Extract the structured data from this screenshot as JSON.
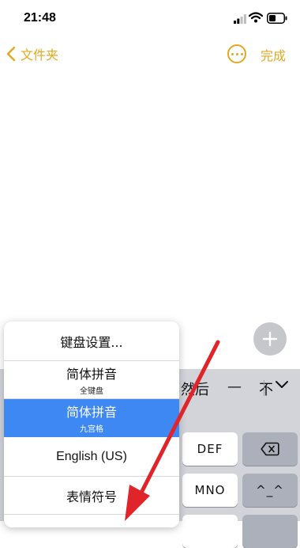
{
  "status_bar": {
    "time": "21:48",
    "icons": [
      "signal-icon",
      "wifi-icon",
      "battery-icon"
    ]
  },
  "nav": {
    "back_label": "文件夹",
    "more_icon": "ellipsis-circle-icon",
    "done_label": "完成",
    "accent_color": "#e2a81f"
  },
  "keyboard": {
    "candidates": [
      "然后",
      "—",
      "不"
    ],
    "keys": {
      "def": "DEF",
      "mno": "MNO",
      "emoticon": "^_^",
      "delete_icon": "delete-backspace-icon"
    }
  },
  "language_menu": {
    "items": [
      {
        "label": "键盘设置...",
        "sub": ""
      },
      {
        "label": "简体拼音",
        "sub": "全键盘"
      },
      {
        "label": "简体拼音",
        "sub": "九宫格",
        "selected": true
      },
      {
        "label": "English (US)",
        "sub": ""
      },
      {
        "label": "表情符号",
        "sub": ""
      }
    ],
    "selected_color": "#3e88f3"
  },
  "annotation": {
    "arrow_color": "#e0242a"
  }
}
